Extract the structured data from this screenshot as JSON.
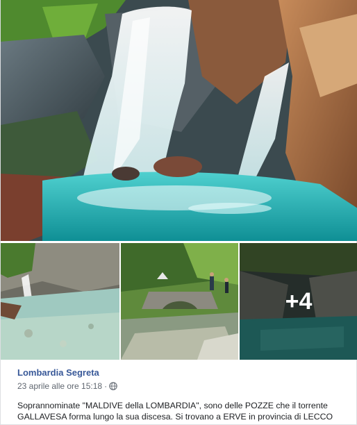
{
  "post": {
    "page_name": "Lombardia Segreta",
    "date": "23 aprile alle ore 15:18",
    "separator": "·",
    "privacy_icon": "globe-icon",
    "text": "Soprannominate \"MALDIVE della LOMBARDIA\", sono delle POZZE che il torrente GALLAVESA forma lungo la sua discesa. Si trovano a ERVE in provincia di LECCO"
  },
  "photos": {
    "main_alt": "waterfall",
    "more_count": "+4"
  },
  "colors": {
    "link": "#385898",
    "meta": "#606770",
    "water": "#2bb3b8"
  }
}
